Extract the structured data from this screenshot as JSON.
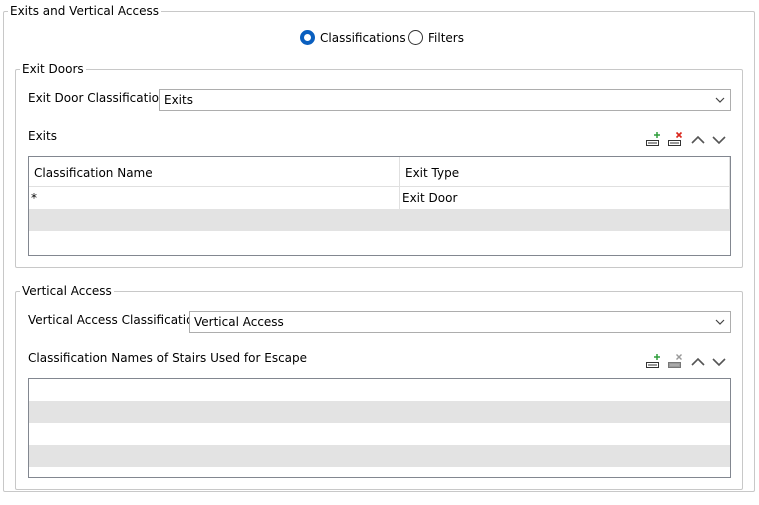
{
  "outer_group": {
    "title": "Exits and Vertical Access"
  },
  "mode": {
    "options": [
      {
        "label": "Classifications",
        "selected": true
      },
      {
        "label": "Filters",
        "selected": false
      }
    ]
  },
  "exit_doors": {
    "title": "Exit Doors",
    "classification_label": "Exit Door Classification",
    "classification_value": "Exits",
    "list_label": "Exits",
    "table": {
      "columns": [
        "Classification Name",
        "Exit Type"
      ],
      "rows": [
        {
          "classification_name": "*",
          "exit_type": "Exit Door"
        }
      ]
    }
  },
  "vertical_access": {
    "title": "Vertical Access",
    "classification_label": "Vertical Access Classification",
    "classification_value": "Vertical Access",
    "list_label": "Classification Names of Stairs Used for Escape"
  },
  "icons": {
    "add": "add-row-icon",
    "delete": "delete-row-icon",
    "up": "move-up-icon",
    "down": "move-down-icon",
    "dropdown": "chevron-down-icon"
  },
  "colors": {
    "radio_selected": "#0a5fbf",
    "add_plus": "#2e9e3a",
    "delete_x": "#d9261c",
    "alt_row": "#e3e3e3"
  }
}
